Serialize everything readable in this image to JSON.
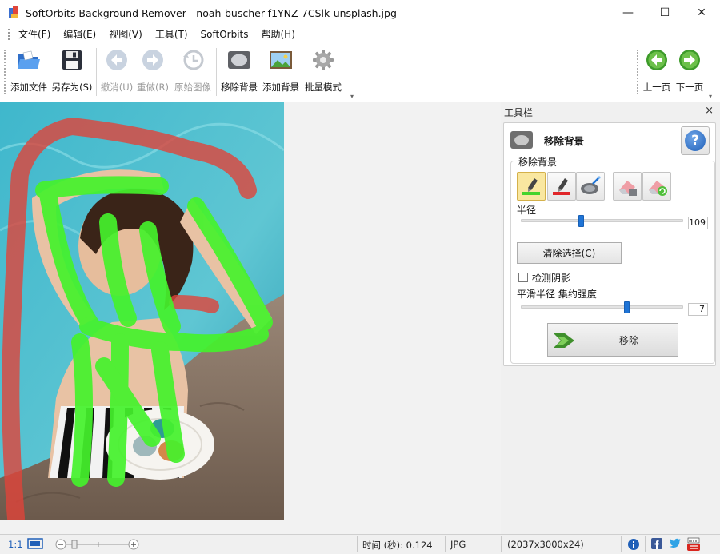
{
  "window": {
    "title": "SoftOrbits Background Remover - noah-buscher-f1YNZ-7CSlk-unsplash.jpg",
    "minimize": "—",
    "maximize": "☐",
    "close": "✕"
  },
  "menu": [
    "文件(F)",
    "编辑(E)",
    "视图(V)",
    "工具(T)",
    "SoftOrbits",
    "帮助(H)"
  ],
  "toolbar": {
    "add_file": "添加文件",
    "save_as": "另存为(S)",
    "undo": "撤消(U)",
    "redo": "重做(R)",
    "original": "原始图像",
    "remove_bg": "移除背景",
    "add_bg": "添加背景",
    "batch": "批量模式",
    "prev": "上一页",
    "next": "下一页"
  },
  "panel": {
    "title": "工具栏",
    "close": "×",
    "header": "移除背景",
    "help": "?",
    "group_label": "移除背景",
    "radius_label": "半径",
    "radius_value": "109",
    "radius_fraction": 0.37,
    "clear_button": "清除选择(C)",
    "detect_shadow": "检测阴影",
    "detect_shadow_checked": false,
    "smooth_label": "平滑半径 集约强度",
    "smooth_value": "7",
    "smooth_fraction": 0.65,
    "remove_button": "移除"
  },
  "statusbar": {
    "zoom_ratio": "1:1",
    "time": "时间 (秒): 0.124",
    "format": "JPG",
    "dimensions": "(2037x3000x24)"
  },
  "colors": {
    "keep_marker": "#45f22c",
    "remove_marker": "#e0443a",
    "accent": "#1f74d6"
  }
}
